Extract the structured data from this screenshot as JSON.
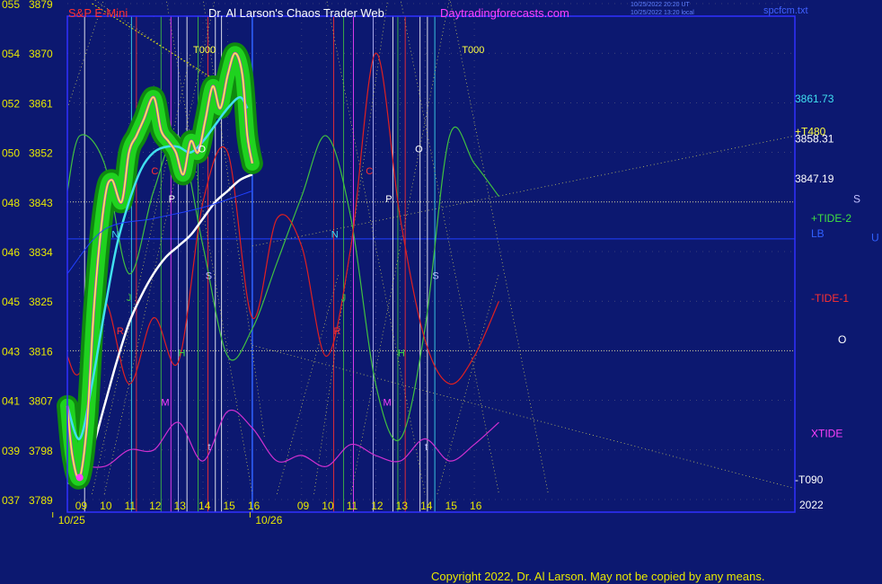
{
  "header": {
    "instrument": "S&P E-Mini",
    "title": "Dr. Al Larson's Chaos Trader Web",
    "site": "Daytradingforecasts.com",
    "update_line1": "10/25/2022 20:20 UT",
    "update_line2": "10/25/2022 13:20 local",
    "file": "spcfcm.txt"
  },
  "footer": {
    "copyright": "Copyright 2022, Dr. Al Larson. May not be copied by any means."
  },
  "colors": {
    "background": "#0c1870",
    "frame": "#3030ff",
    "price": "#ffff40",
    "halo": "#1fd21f",
    "avg_fast": "#40e0f0",
    "avg_slow": "#ffffff",
    "tide_pos": "#40c040",
    "tide_neg": "#e02020",
    "xtide": "#d030d0",
    "axis_text": "#e8e800"
  },
  "chart_data": {
    "type": "line",
    "title": "S&P E-Mini",
    "y_axis": {
      "range": [
        3789,
        3879
      ],
      "tick_labels": [
        {
          "left": "055",
          "price": "3879"
        },
        {
          "left": "054",
          "price": "3870"
        },
        {
          "left": "052",
          "price": "3861"
        },
        {
          "left": "050",
          "price": "3852"
        },
        {
          "left": "048",
          "price": "3843"
        },
        {
          "left": "046",
          "price": "3834"
        },
        {
          "left": "045",
          "price": "3825"
        },
        {
          "left": "043",
          "price": "3816"
        },
        {
          "left": "041",
          "price": "3807"
        },
        {
          "left": "039",
          "price": "3798"
        },
        {
          "left": "037",
          "price": "3789"
        }
      ]
    },
    "x_axis": {
      "range_hours": [
        8.5,
        38
      ],
      "tick_labels": [
        "09",
        "10",
        "11",
        "12",
        "13",
        "14",
        "15",
        "16",
        "09",
        "10",
        "11",
        "12",
        "13",
        "14",
        "15",
        "16"
      ],
      "tick_hours": [
        9,
        10,
        11,
        12,
        13,
        14,
        15,
        16,
        18,
        19,
        20,
        21,
        22,
        23,
        24,
        25
      ],
      "dates": [
        {
          "label": "10/25",
          "hour": 9
        },
        {
          "label": "10/26",
          "hour": 17
        }
      ],
      "year_label": "2022"
    },
    "grid": true,
    "series": [
      {
        "name": "S&P E-Mini",
        "hours": [
          8.5,
          8.7,
          9.0,
          9.3,
          9.6,
          10.0,
          10.3,
          10.7,
          11.0,
          11.3,
          11.6,
          12.0,
          12.3,
          12.6,
          12.9,
          13.2,
          13.5,
          13.8,
          14.1,
          14.4,
          14.7,
          15.0,
          15.3,
          15.6,
          15.8,
          16.0
        ],
        "values": [
          3806,
          3797,
          3793,
          3803,
          3825,
          3843,
          3847,
          3843,
          3852,
          3855,
          3858,
          3862,
          3856,
          3854,
          3852,
          3848,
          3854,
          3852,
          3858,
          3864,
          3860,
          3866,
          3870,
          3866,
          3855,
          3850
        ]
      },
      {
        "name": "avg-fast",
        "hours": [
          8.5,
          9.0,
          9.5,
          10.0,
          10.5,
          11.0,
          11.5,
          12.0,
          12.5,
          13.0,
          13.5,
          14.0,
          14.5,
          15.0,
          15.5,
          15.8
        ],
        "values": [
          3806,
          3800,
          3810,
          3823,
          3835,
          3843,
          3849,
          3852,
          3853,
          3853,
          3852,
          3854,
          3857,
          3860,
          3862,
          3860
        ]
      },
      {
        "name": "avg-slow",
        "hours": [
          8.5,
          9.0,
          9.5,
          10.0,
          10.5,
          11.0,
          11.5,
          12.0,
          12.5,
          13.0,
          13.5,
          14.0,
          14.5,
          15.0,
          15.5,
          16.0
        ],
        "values": [
          3792,
          3793,
          3798,
          3806,
          3814,
          3821,
          3826,
          3830,
          3833,
          3835,
          3837,
          3840,
          3843,
          3845,
          3847,
          3848
        ]
      },
      {
        "name": "+TIDE-2",
        "hours": [
          8.5,
          9,
          10,
          11,
          12,
          13,
          14,
          15,
          16,
          17,
          18,
          19,
          20,
          21,
          22,
          23,
          24,
          25,
          26
        ],
        "values": [
          3845,
          3855,
          3850,
          3830,
          3845,
          3855,
          3835,
          3815,
          3820,
          3832,
          3844,
          3855,
          3840,
          3810,
          3800,
          3820,
          3855,
          3850,
          3844
        ]
      },
      {
        "name": "-TIDE-1",
        "hours": [
          8.5,
          9,
          10,
          11,
          12,
          13,
          14,
          15,
          16,
          17,
          18,
          19,
          20,
          21,
          22,
          23,
          24,
          25,
          26
        ],
        "values": [
          3815,
          3812,
          3825,
          3810,
          3822,
          3814,
          3843,
          3852,
          3822,
          3840,
          3835,
          3815,
          3835,
          3870,
          3840,
          3818,
          3810,
          3815,
          3825
        ]
      },
      {
        "name": "XTIDE",
        "hours": [
          8.5,
          9,
          10,
          11,
          12,
          13,
          14,
          15,
          16,
          17,
          18,
          19,
          20,
          21,
          22,
          23,
          24,
          25,
          26
        ],
        "values": [
          3802,
          3796,
          3795,
          3798,
          3798,
          3803,
          3796,
          3805,
          3802,
          3796,
          3797,
          3795,
          3799,
          3797,
          3796,
          3800,
          3796,
          3799,
          3803
        ]
      }
    ],
    "right_labels": [
      {
        "text": "3861.73",
        "price": 3861.73,
        "color": "#40e0f0"
      },
      {
        "text": "+T480",
        "price": 3855.8,
        "color": "#ffff40"
      },
      {
        "text": "3858.31",
        "price": 3854.5,
        "color": "#ffffff"
      },
      {
        "text": "3847.19",
        "price": 3847.19,
        "color": "#ffffff"
      },
      {
        "text": "+TIDE-2",
        "price": 3840,
        "color": "#40e040"
      },
      {
        "text": "LB",
        "price": 3837.3,
        "color": "#3060ff"
      },
      {
        "text": "-TIDE-1",
        "price": 3825.5,
        "color": "#ff3030"
      },
      {
        "text": "O",
        "price": 3818,
        "color": "#ffffff"
      },
      {
        "text": "XTIDE",
        "price": 3801,
        "color": "#ff40ff"
      },
      {
        "text": "-T090",
        "price": 3792.6,
        "color": "#ffffff"
      },
      {
        "text": "S",
        "price": 3843.5,
        "color": "#c0c0ff"
      },
      {
        "text": "U",
        "price": 3836.5,
        "color": "#3060ff"
      }
    ],
    "annotations": [
      {
        "text": "T000",
        "hour": 13.6,
        "price": 3870,
        "color": "#ffff40"
      },
      {
        "text": "T000",
        "hour": 24.5,
        "price": 3870,
        "color": "#ffff40"
      },
      {
        "text": "N",
        "hour": 10.3,
        "price": 3836.5,
        "color": "#40e0f0"
      },
      {
        "text": "N",
        "hour": 19.2,
        "price": 3836.5,
        "color": "#40e0f0"
      },
      {
        "text": "P",
        "hour": 12.6,
        "price": 3843,
        "color": "#ffffff"
      },
      {
        "text": "P",
        "hour": 21.4,
        "price": 3843,
        "color": "#ffffff"
      },
      {
        "text": "O",
        "hour": 13.8,
        "price": 3852,
        "color": "#ffffff"
      },
      {
        "text": "O",
        "hour": 22.6,
        "price": 3852,
        "color": "#ffffff"
      },
      {
        "text": "C",
        "hour": 11.9,
        "price": 3848,
        "color": "#ff3030"
      },
      {
        "text": "C",
        "hour": 20.6,
        "price": 3848,
        "color": "#ff3030"
      },
      {
        "text": "S",
        "hour": 14.1,
        "price": 3829,
        "color": "#c0c0ff"
      },
      {
        "text": "S",
        "hour": 23.3,
        "price": 3829,
        "color": "#c0c0ff"
      },
      {
        "text": "J",
        "hour": 10.9,
        "price": 3825,
        "color": "#40c040"
      },
      {
        "text": "J",
        "hour": 19.6,
        "price": 3825,
        "color": "#40c040"
      },
      {
        "text": "R",
        "hour": 10.5,
        "price": 3819,
        "color": "#ff3030"
      },
      {
        "text": "R",
        "hour": 19.3,
        "price": 3819,
        "color": "#ff3030"
      },
      {
        "text": "H",
        "hour": 13.0,
        "price": 3815,
        "color": "#40e040"
      },
      {
        "text": "H",
        "hour": 21.9,
        "price": 3815,
        "color": "#40e040"
      },
      {
        "text": "M",
        "hour": 12.3,
        "price": 3806,
        "color": "#ff40ff"
      },
      {
        "text": "M",
        "hour": 21.3,
        "price": 3806,
        "color": "#ff40ff"
      },
      {
        "text": "t",
        "hour": 14.2,
        "price": 3798,
        "color": "#c0c0ff"
      },
      {
        "text": "t",
        "hour": 23.0,
        "price": 3798,
        "color": "#c0c0ff"
      }
    ]
  }
}
